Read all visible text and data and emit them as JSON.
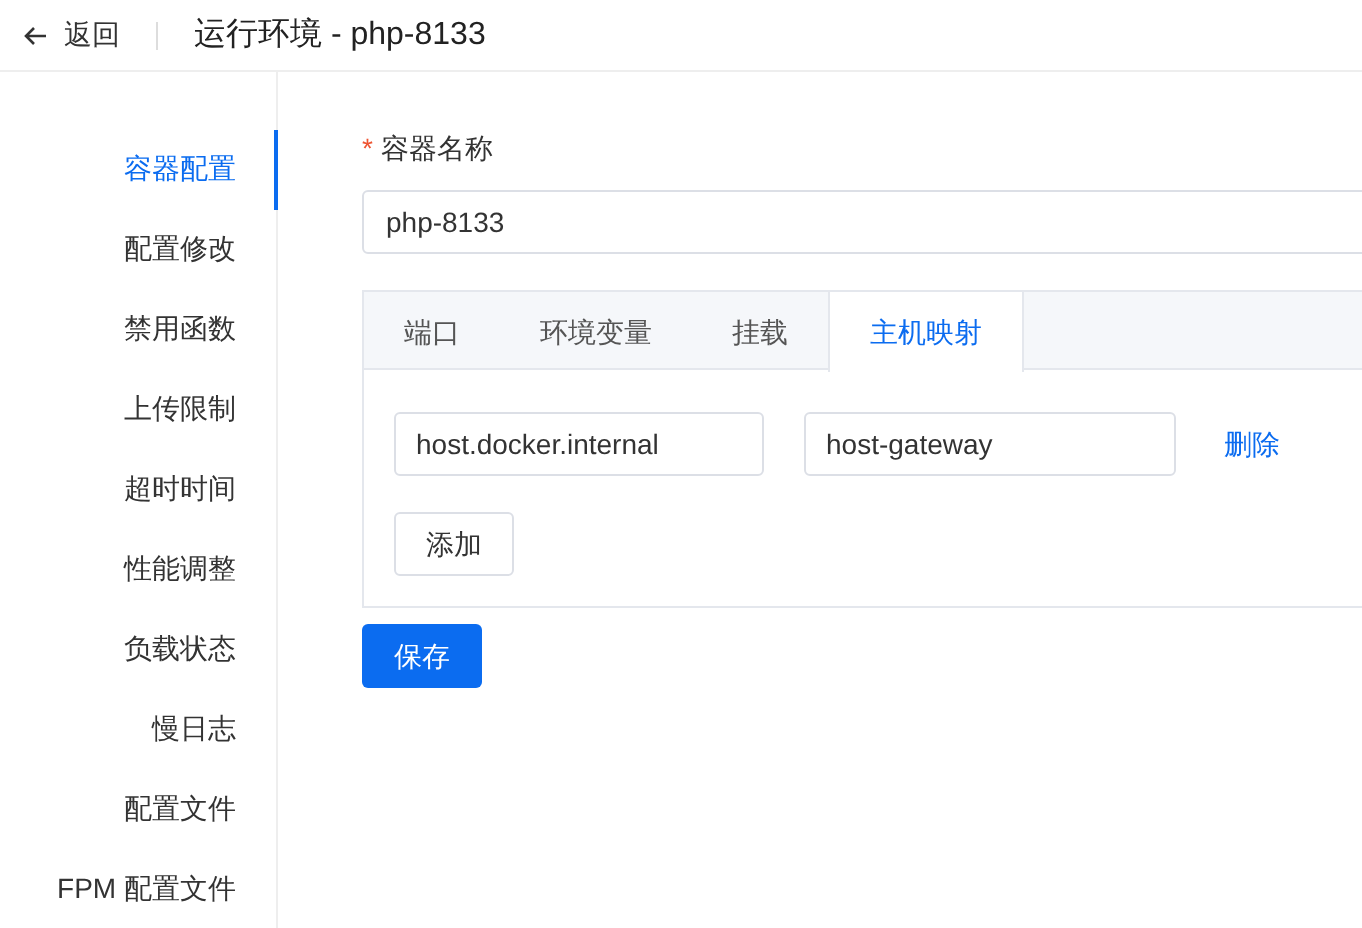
{
  "header": {
    "back": "返回",
    "title": "运行环境 - php-8133"
  },
  "sidebar": {
    "items": [
      {
        "label": "容器配置",
        "selected": true
      },
      {
        "label": "配置修改",
        "selected": false
      },
      {
        "label": "禁用函数",
        "selected": false
      },
      {
        "label": "上传限制",
        "selected": false
      },
      {
        "label": "超时时间",
        "selected": false
      },
      {
        "label": "性能调整",
        "selected": false
      },
      {
        "label": "负载状态",
        "selected": false
      },
      {
        "label": "慢日志",
        "selected": false
      },
      {
        "label": "配置文件",
        "selected": false
      },
      {
        "label": "FPM 配置文件",
        "selected": false
      }
    ]
  },
  "form": {
    "required_mark": "*",
    "label": "容器名称",
    "value": "php-8133"
  },
  "tabs": [
    {
      "label": "端口",
      "selected": false
    },
    {
      "label": "环境变量",
      "selected": false
    },
    {
      "label": "挂载",
      "selected": false
    },
    {
      "label": "主机映射",
      "selected": true
    }
  ],
  "host_rows": [
    {
      "host": "host.docker.internal",
      "ip": "host-gateway",
      "delete": "删除"
    }
  ],
  "add_button": "添加",
  "save_button": "保存"
}
